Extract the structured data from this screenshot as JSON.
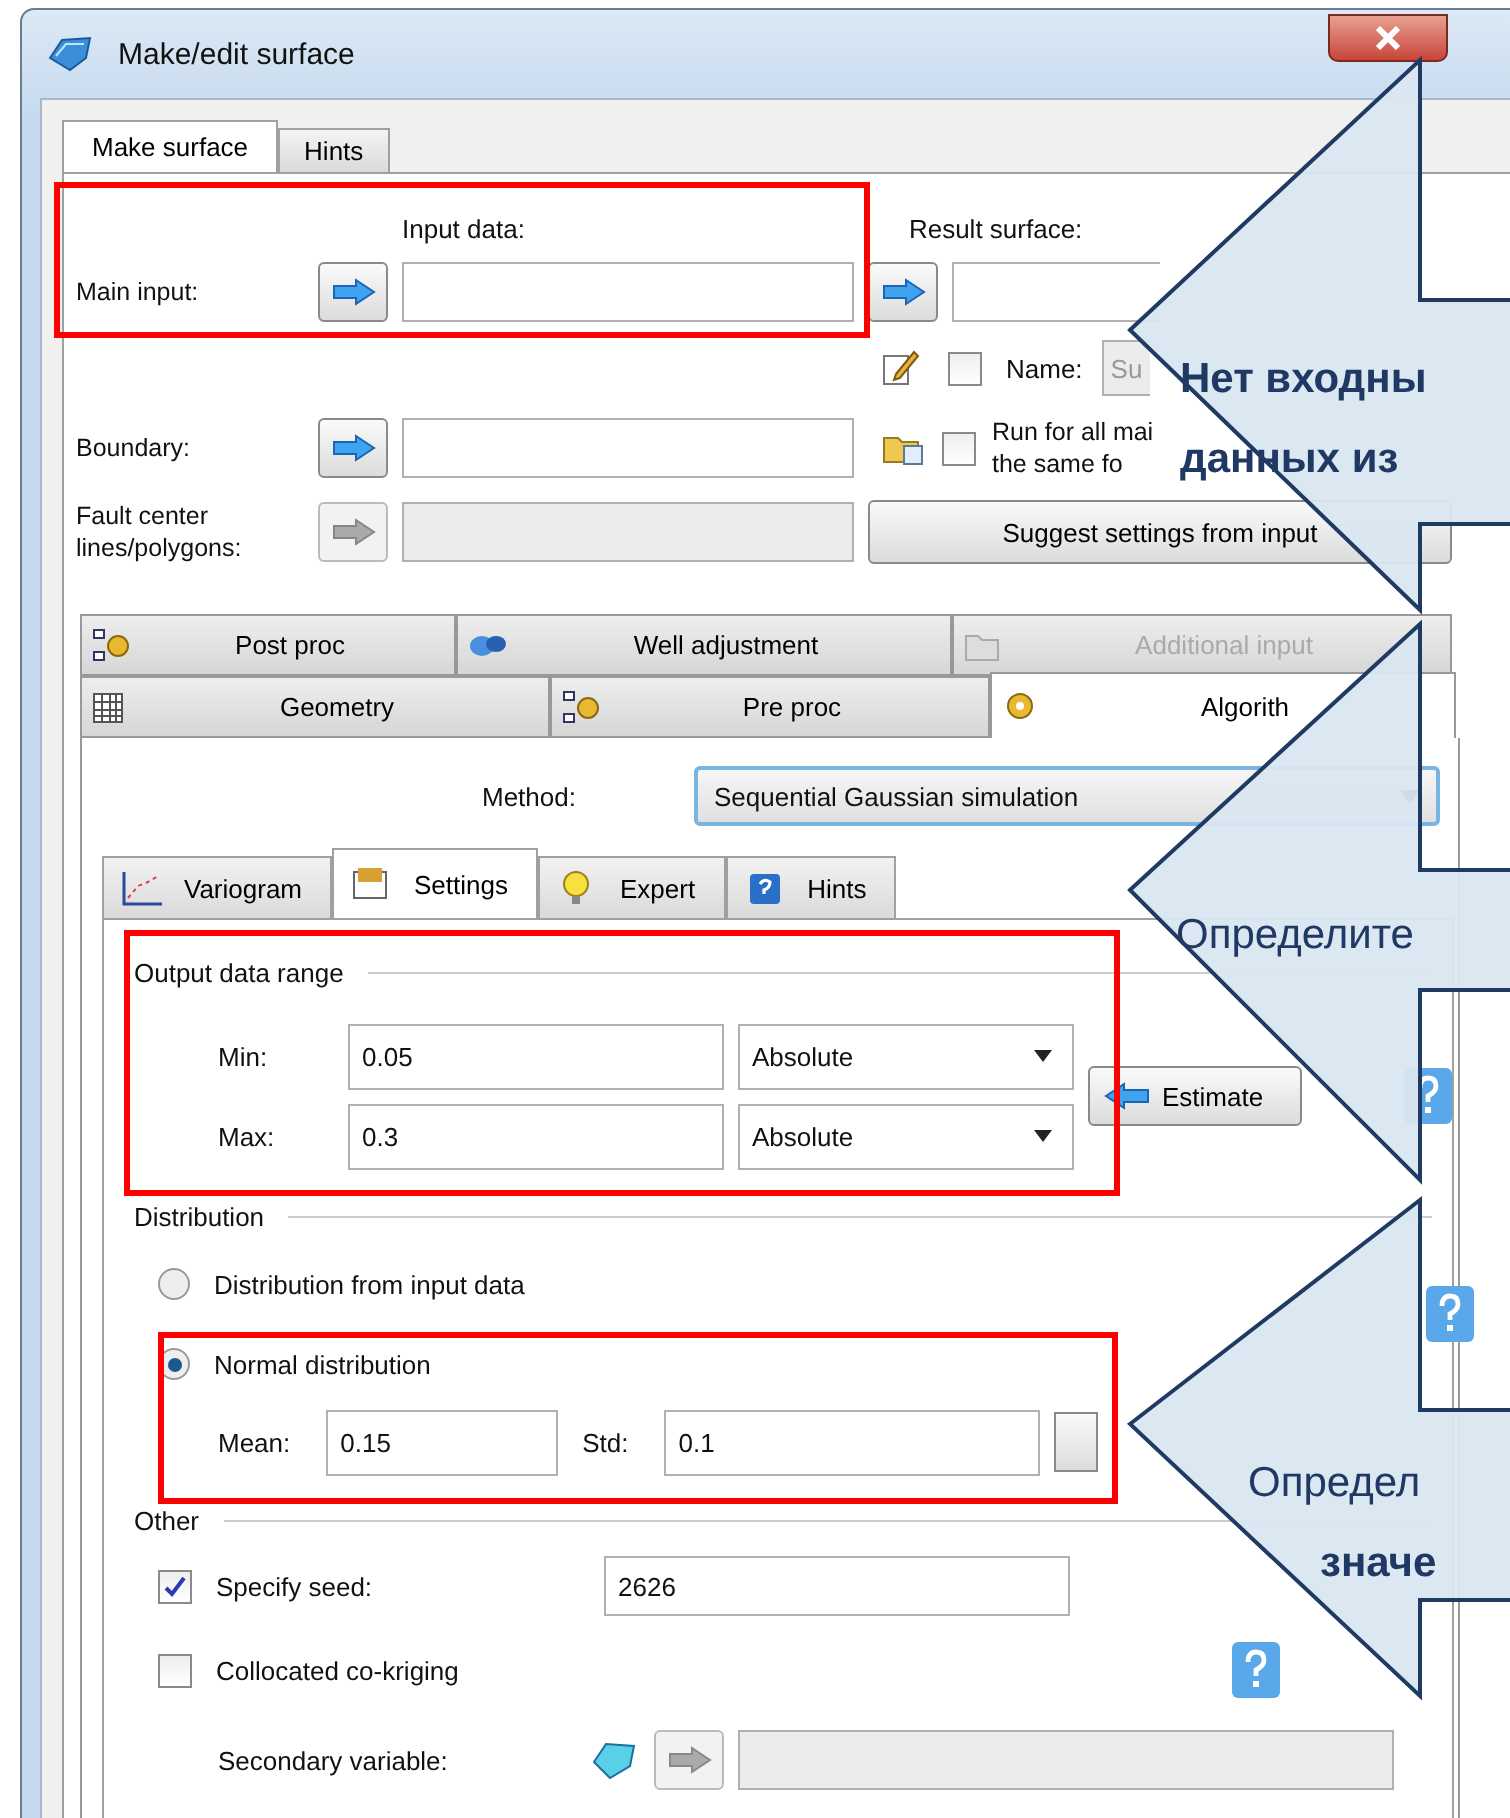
{
  "window": {
    "title": "Make/edit surface"
  },
  "tabs": [
    {
      "label": "Make surface",
      "selected": true
    },
    {
      "label": "Hints",
      "selected": false
    }
  ],
  "io": {
    "input_header": "Input data:",
    "result_header": "Result surface:",
    "main_input_label": "Main input:",
    "name_label": "Name:",
    "name_value": "Su",
    "name_checked": false,
    "boundary_label": "Boundary:",
    "run_all_lines": [
      "Run for all mai",
      "the same fo"
    ],
    "run_all_checked": false,
    "fault_label_lines": [
      "Fault center",
      "lines/polygons:"
    ],
    "suggest_button": "Suggest settings from input"
  },
  "section_tabs": [
    [
      {
        "label": "Post proc",
        "selected": false,
        "disabled": false
      },
      {
        "label": "Well adjustment",
        "selected": false,
        "disabled": false
      },
      {
        "label": "Additional input",
        "selected": false,
        "disabled": true
      }
    ],
    [
      {
        "label": "Geometry",
        "selected": false,
        "disabled": false
      },
      {
        "label": "Pre proc",
        "selected": false,
        "disabled": false
      },
      {
        "label": "Algorith",
        "selected": true,
        "disabled": false
      }
    ]
  ],
  "method": {
    "label": "Method:",
    "value": "Sequential Gaussian simulation"
  },
  "sub_tabs": [
    {
      "label": "Variogram",
      "selected": false
    },
    {
      "label": "Settings",
      "selected": true
    },
    {
      "label": "Expert",
      "selected": false
    },
    {
      "label": "Hints",
      "selected": false
    }
  ],
  "output_range": {
    "title": "Output data range",
    "rows": [
      {
        "label": "Min:",
        "value": "0.05",
        "mode": "Absolute"
      },
      {
        "label": "Max:",
        "value": "0.3",
        "mode": "Absolute"
      }
    ],
    "estimate_button": "Estimate"
  },
  "distribution": {
    "title": "Distribution",
    "options": [
      {
        "label": "Distribution from input data",
        "selected": false
      },
      {
        "label": "Normal distribution",
        "selected": true
      }
    ],
    "mean_label": "Mean:",
    "mean": "0.15",
    "std_label": "Std:",
    "std": "0.1"
  },
  "other": {
    "title": "Other",
    "seed": {
      "label": "Specify seed:",
      "checked": true,
      "value": "2626"
    },
    "cokriging": {
      "label": "Collocated co-kriging",
      "checked": false
    },
    "secondary_label": "Secondary variable:"
  },
  "callouts": [
    {
      "lines": [
        {
          "text": "Нет входны",
          "bold": true
        },
        {
          "text": "данных из",
          "bold": true
        }
      ]
    },
    {
      "lines": [
        {
          "text": "Определите",
          "bold": false
        }
      ]
    },
    {
      "lines": [
        {
          "text": "Определ",
          "bold": false
        },
        {
          "text": "значе",
          "bold": true
        }
      ]
    }
  ]
}
